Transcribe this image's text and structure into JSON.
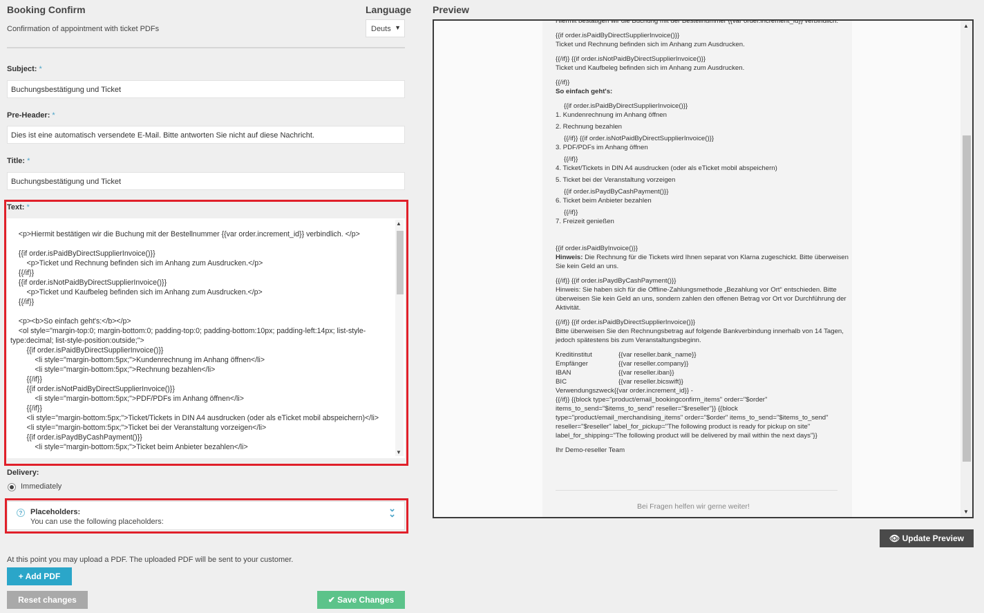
{
  "header": {
    "title": "Booking Confirm",
    "subtitle": "Confirmation of appointment with ticket PDFs",
    "language_label": "Language",
    "language_value": "Deuts"
  },
  "form": {
    "subject_label": "Subject:",
    "subject_value": "Buchungsbestätigung und Ticket",
    "preheader_label": "Pre-Header:",
    "preheader_value": "Dies ist eine automatisch versendete E-Mail. Bitte antworten Sie nicht auf diese Nachricht.",
    "title_label": "Title:",
    "title_value": "Buchungsbestätigung und Ticket",
    "text_label": "Text:",
    "required_mark": "*",
    "text_value": "\n    <p>Hiermit bestätigen wir die Buchung mit der Bestellnummer {{var order.increment_id}} verbindlich. </p>\n\n    {{if order.isPaidByDirectSupplierInvoice()}}\n        <p>Ticket und Rechnung befinden sich im Anhang zum Ausdrucken.</p>\n    {{/if}}\n    {{if order.isNotPaidByDirectSupplierInvoice()}}\n        <p>Ticket und Kaufbeleg befinden sich im Anhang zum Ausdrucken.</p>\n    {{/if}}\n\n    <p><b>So einfach geht's:</b></p>\n    <ol style=\"margin-top:0; margin-bottom:0; padding-top:0; padding-bottom:10px; padding-left:14px; list-style-type:decimal; list-style-position:outside;\">\n        {{if order.isPaidByDirectSupplierInvoice()}}\n            <li style=\"margin-bottom:5px;\">Kundenrechnung im Anhang öffnen</li>\n            <li style=\"margin-bottom:5px;\">Rechnung bezahlen</li>\n        {{/if}}\n        {{if order.isNotPaidByDirectSupplierInvoice()}}\n            <li style=\"margin-bottom:5px;\">PDF/PDFs im Anhang öffnen</li>\n        {{/if}}\n        <li style=\"margin-bottom:5px;\">Ticket/Tickets in DIN A4 ausdrucken (oder als eTicket mobil abspeichern)</li>\n        <li style=\"margin-bottom:5px;\">Ticket bei der Veranstaltung vorzeigen</li>\n        {{if order.isPaydByCashPayment()}}\n            <li style=\"margin-bottom:5px;\">Ticket beim Anbieter bezahlen</li>",
    "delivery_label": "Delivery:",
    "delivery_option": "Immediately"
  },
  "placeholders": {
    "title": "Placeholders:",
    "text": "You can use the following placeholders:"
  },
  "upload": {
    "note": "At this point you may upload a PDF. The uploaded PDF will be sent to your customer.",
    "add_pdf": "+ Add PDF"
  },
  "actions": {
    "reset": "Reset changes",
    "save": "✔ Save Changes",
    "update_preview": "Update Preview"
  },
  "preview": {
    "label": "Preview",
    "lines_top": "Hiermit bestätigen wir die Buchung mit der Bestellnummer {{var order.increment_id}} verbindlich.",
    "p1": "{{if order.isPaidByDirectSupplierInvoice()}}",
    "p1b": "Ticket und Rechnung befinden sich im Anhang zum Ausdrucken.",
    "p2": "{{/if}} {{if order.isNotPaidByDirectSupplierInvoice()}}",
    "p2b": "Ticket und Kaufbeleg befinden sich im Anhang zum Ausdrucken.",
    "p3": "{{/if}}",
    "so_einfach": "So einfach geht's:",
    "l0": "{{if order.isPaidByDirectSupplierInvoice()}}",
    "l1": "1. Kundenrechnung im Anhang öffnen",
    "l2": "2. Rechnung bezahlen",
    "l2b": "{{/if}} {{if order.isNotPaidByDirectSupplierInvoice()}}",
    "l3": "3. PDF/PDFs im Anhang öffnen",
    "l3b": "{{/if}}",
    "l4": "4. Ticket/Tickets in DIN A4 ausdrucken (oder als eTicket mobil abspeichern)",
    "l5": "5. Ticket bei der Veranstaltung vorzeigen",
    "l5b": "{{if order.isPaydByCashPayment()}}",
    "l6": "6. Ticket beim Anbieter bezahlen",
    "l6b": "{{/if}}",
    "l7": "7. Freizeit genießen",
    "h1": "{{if order.isPaidByInvoice()}}",
    "hinweis": "Hinweis:",
    "h1t": " Die Rechnung für die Tickets wird Ihnen separat von Klarna zugeschickt. Bitte überweisen Sie kein Geld an uns.",
    "h2": "{{/if}} {{if order.isPaydByCashPayment()}}",
    "h2t": "Hinweis: Sie haben sich für die Offline-Zahlungsmethode „Bezahlung vor Ort“ entschieden. Bitte überweisen Sie kein Geld an uns, sondern zahlen den offenen Betrag vor Ort vor Durchführung der Aktivität.",
    "h3": "{{/if}} {{if order.isPaidByDirectSupplierInvoice()}}",
    "h3t": "Bitte überweisen Sie den Rechnungsbetrag auf folgende Bankverbindung innerhalb von 14 Tagen, jedoch spätestens bis zum Veranstaltungsbeginn.",
    "bank": [
      {
        "k": "Kreditinstitut",
        "v": "{{var reseller.bank_name}}"
      },
      {
        "k": "Empfänger",
        "v": "{{var reseller.company}}"
      },
      {
        "k": "IBAN",
        "v": "{{var reseller.iban}}"
      },
      {
        "k": "BIC",
        "v": "{{var reseller.bicswift}}"
      }
    ],
    "vzweck": "Verwendungszweck{{var order.increment_id}} -",
    "block": "{{/if}} {{block type=\"product/email_bookingconfirm_items\" order=\"$order\" items_to_send=\"$items_to_send\" reseller=\"$reseller\"}} {{block type=\"product/email_merchandising_items\" order=\"$order\" items_to_send=\"$items_to_send\" reseller=\"$reseller\" label_for_pickup=\"The following product is ready for pickup on site\" label_for_shipping=\"The following product will be delivered by mail within the next days\"}}",
    "team": "Ihr Demo-reseller Team",
    "footer": "Bei Fragen helfen wir gerne weiter!"
  }
}
